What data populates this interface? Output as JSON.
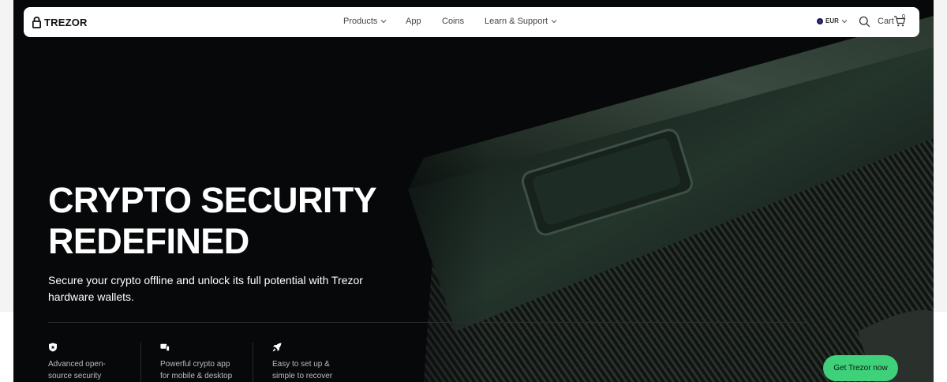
{
  "brand": {
    "name": "TREZOR"
  },
  "nav": {
    "products": "Products",
    "app": "App",
    "coins": "Coins",
    "learn_support": "Learn & Support",
    "currency": "EUR",
    "cart": "Cart",
    "cart_count": "0"
  },
  "hero": {
    "title_line1": "CRYPTO SECURITY",
    "title_line2": "REDEFINED",
    "subtitle": "Secure your crypto offline and unlock its full potential with Trezor hardware wallets."
  },
  "features": [
    {
      "icon": "shield-star-icon",
      "line1": "Advanced open-",
      "line2": "source security"
    },
    {
      "icon": "devices-icon",
      "line1": "Powerful crypto app",
      "line2": "for mobile & desktop"
    },
    {
      "icon": "rocket-icon",
      "line1": "Easy to set up &",
      "line2": "simple to recover"
    }
  ],
  "cta": {
    "label": "Get Trezor now"
  },
  "colors": {
    "cta": "#3fd07a",
    "hero_bg": "#07080a",
    "device": "#1e2d26"
  }
}
